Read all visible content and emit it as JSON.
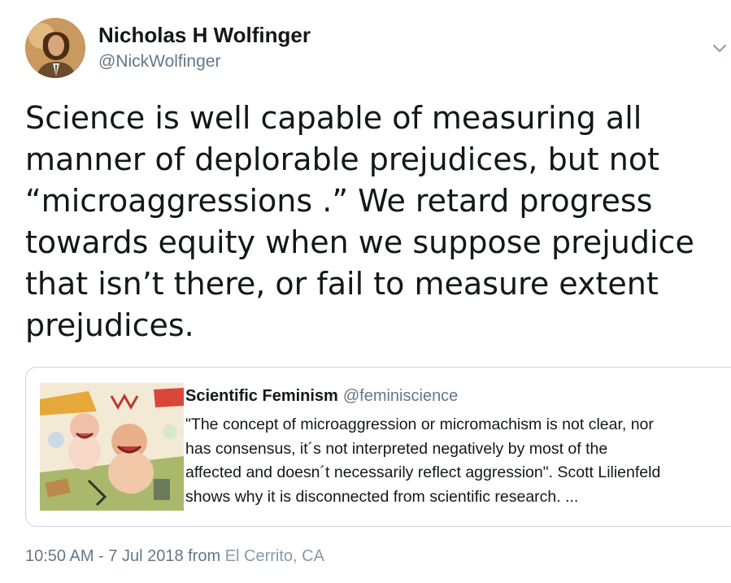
{
  "tweet": {
    "author": {
      "display_name": "Nicholas H Wolfinger",
      "handle": "@NickWolfinger",
      "avatar_icon": "user-avatar"
    },
    "menu_icon": "chevron-down-icon",
    "text": "Science is well capable of measuring all\nmanner of deplorable prejudices, but not\n“microaggressions .” We retard progress\ntowards equity when we suppose prejudice\nthat isn’t there, or fail to measure extent\nprejudices.",
    "quoted": {
      "name": "Scientific Feminism",
      "handle": "@feminiscience",
      "text": "\"The concept of microaggression or micromachism is not clear, nor\nhas consensus, it´s not interpreted negatively by most of the\naffected and doesn´t necessarily reflect aggression\". Scott Lilienfeld\nshows why it is disconnected from scientific research. ...",
      "thumbnail_icon": "cartoon-thumbnail"
    },
    "meta": {
      "time": "10:50 AM - 7 Jul 2018 from ",
      "location": "El Cerrito, CA"
    }
  },
  "colors": {
    "text": "#14171a",
    "secondary": "#657786",
    "border": "#ccd6dd"
  }
}
